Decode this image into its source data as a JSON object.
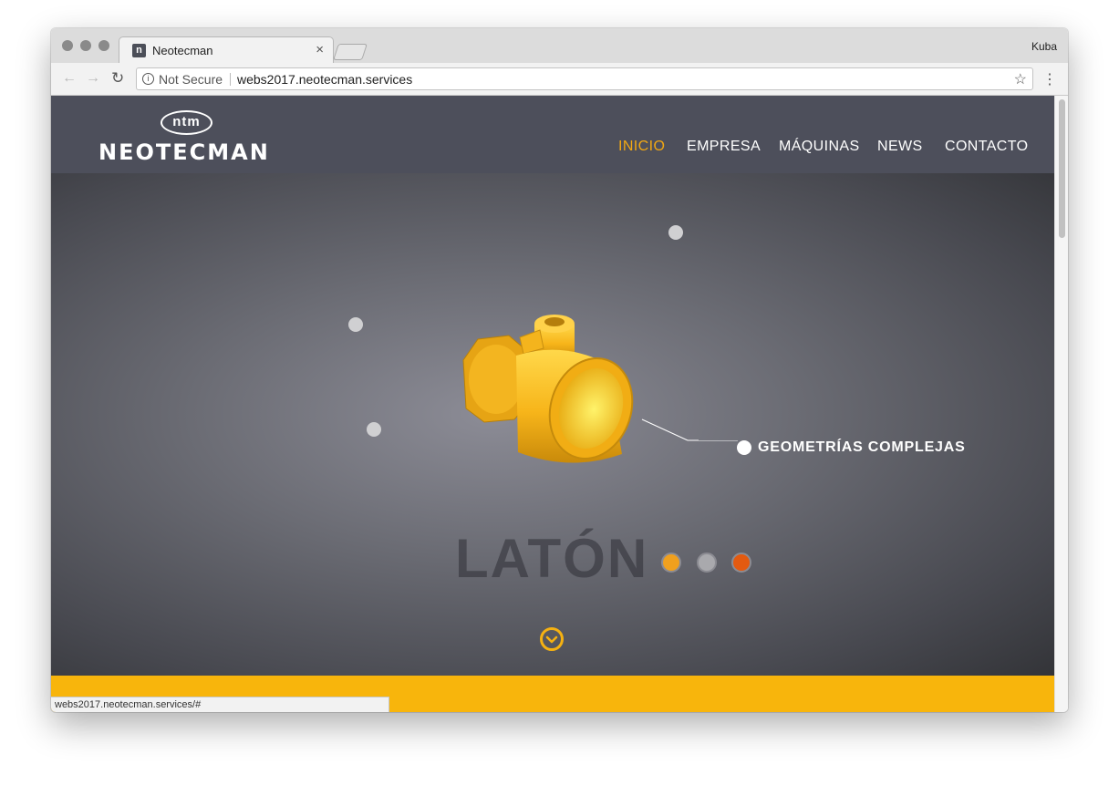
{
  "browser": {
    "tab_title": "Neotecman",
    "favicon_letter": "n",
    "tab_close": "×",
    "profile_name": "Kuba",
    "security_label": "Not Secure",
    "info_glyph": "i",
    "url": "webs2017.neotecman.services",
    "status_url": "webs2017.neotecman.services/#",
    "glyphs": {
      "back": "←",
      "forward": "→",
      "reload": "↻",
      "star": "☆",
      "menu": "⋮"
    }
  },
  "site": {
    "logo_badge": "ntm",
    "logo_word": "NEOTECMAN",
    "nav": [
      {
        "label": "INICIO"
      },
      {
        "label": "EMPRESA"
      },
      {
        "label": "MÁQUINAS"
      },
      {
        "label": "NEWS"
      },
      {
        "label": "CONTACTO"
      }
    ],
    "hero": {
      "callout": "GEOMETRÍAS COMPLEJAS",
      "material_label": "LATÓN",
      "swatches": [
        "#f0a01e",
        "#a9a9ad",
        "#e35a10"
      ]
    }
  },
  "colors": {
    "accent": "#f2a813",
    "header_bg": "#4d4f5b",
    "band": "#f8b50c"
  }
}
